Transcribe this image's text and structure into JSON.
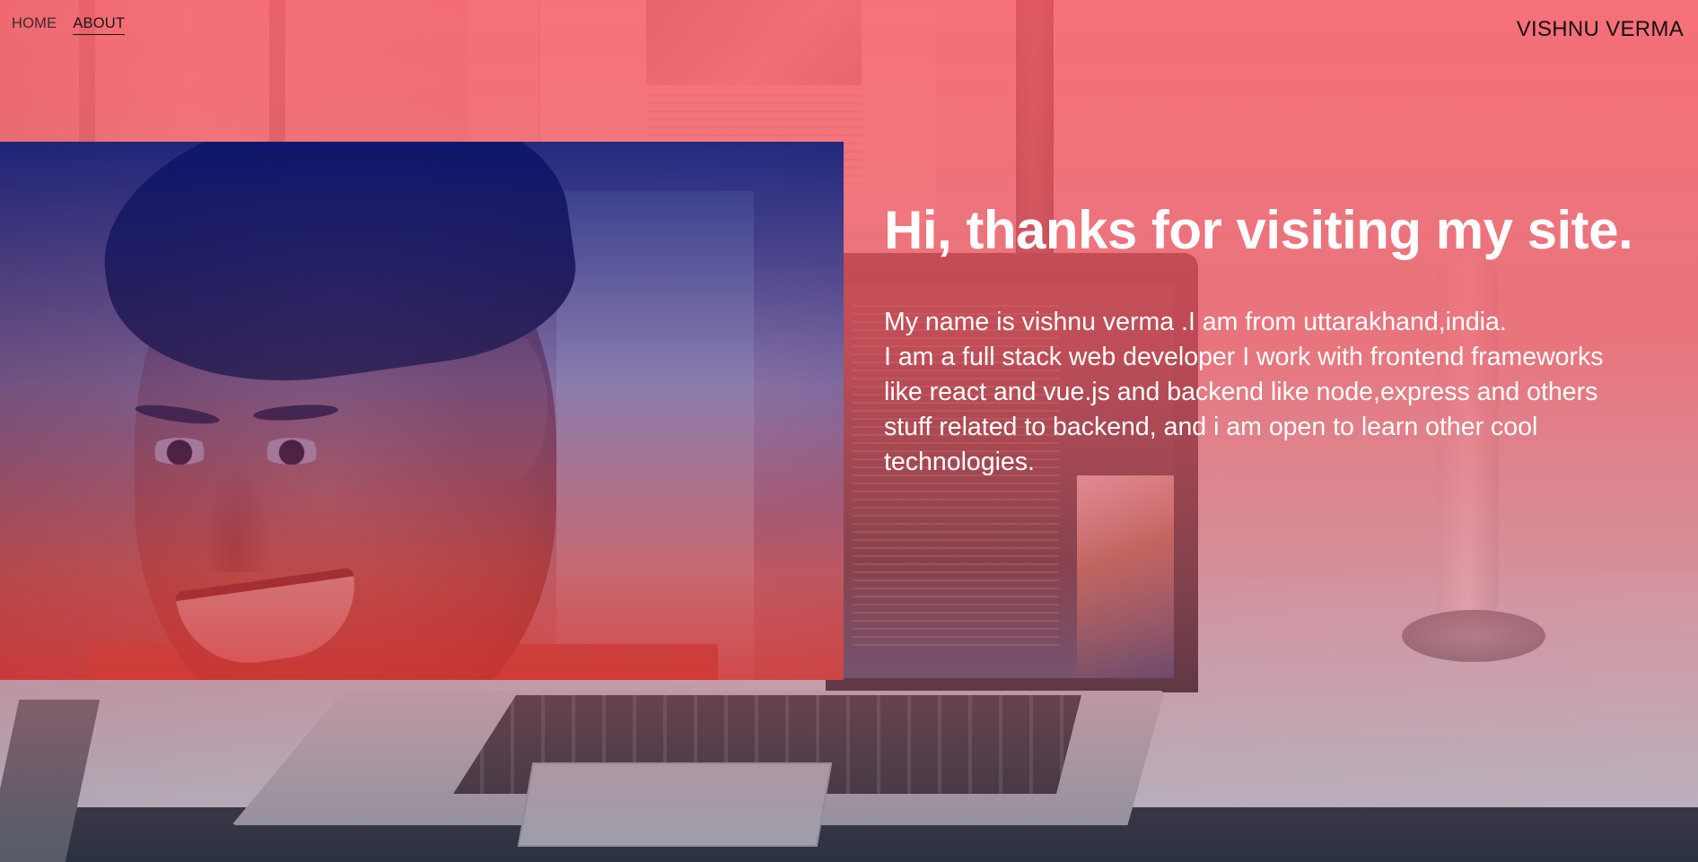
{
  "nav": {
    "items": [
      {
        "label": "HOME",
        "active": false
      },
      {
        "label": "ABOUT",
        "active": true
      }
    ]
  },
  "brand": {
    "name": "VISHNU VERMA"
  },
  "hero": {
    "title": "Hi, thanks for visiting my site.",
    "intro_line": "My name is vishnu verma .I am from uttarakhand,india.",
    "description": "I am a full stack web developer I work with frontend frameworks like react and vue.js and backend like node,express and others stuff related to backend, and i am open to learn other cool technologies."
  },
  "colors": {
    "overlay_top": "#f85c66",
    "portrait_tint_top": "#0c1878",
    "portrait_tint_bottom": "#d22828",
    "text": "#ffffff"
  }
}
